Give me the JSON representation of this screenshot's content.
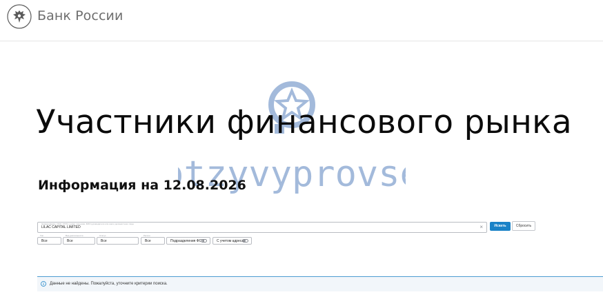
{
  "header": {
    "brand": "Банк России"
  },
  "page": {
    "title": "Участники финансового рынка",
    "info_date": "Информация на 12.08.2026"
  },
  "watermark": {
    "text": "otzyvyprovse"
  },
  "search": {
    "label": "Наименование, ИНН, ОГРН, номер лицензии, ФИО руководителя или иного должностного лица",
    "value": "LILAC CAPITAL LIMITED"
  },
  "buttons": {
    "find": "Искать",
    "reset": "Сбросить"
  },
  "filters": [
    {
      "label": "Тип",
      "value": "Все"
    },
    {
      "label": "Вид деятельности",
      "value": "Все"
    },
    {
      "label": "Статус",
      "value": "Все"
    },
    {
      "label": "Регион",
      "value": "Все"
    }
  ],
  "toggles": [
    {
      "label": "Подразделения ФО",
      "on": false
    },
    {
      "label": "С учетом адреса",
      "on": false
    }
  ],
  "notice": {
    "text": "Данные не найдены. Пожалуйста, уточните критерии поиска."
  },
  "colors": {
    "accent": "#1a82c7",
    "watermark": "#4a78b8",
    "brand_text": "#6e6e6e"
  }
}
